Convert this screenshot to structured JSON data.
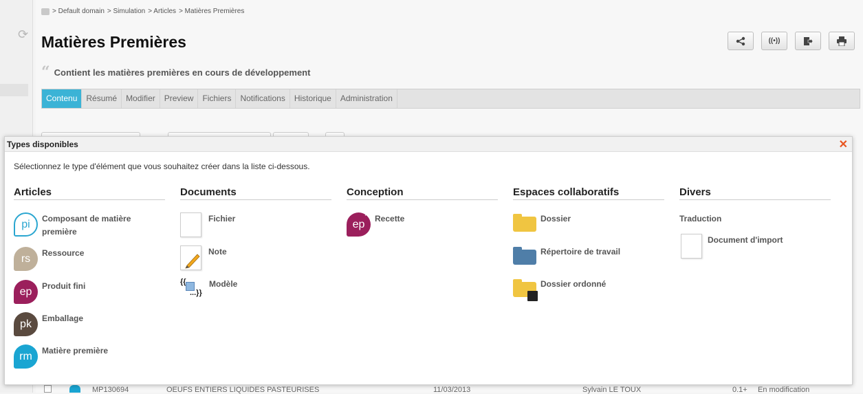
{
  "breadcrumb": [
    "> Default domain",
    "> Simulation",
    "> Articles",
    "> Matières Premières"
  ],
  "page": {
    "title": "Matières Premières",
    "description": "Contient les matières premières en cours de développement"
  },
  "actions": [
    {
      "name": "share-icon",
      "glyph": "⋔"
    },
    {
      "name": "broadcast-icon",
      "glyph": "((•))"
    },
    {
      "name": "export-icon",
      "glyph": "⇥"
    },
    {
      "name": "print-icon",
      "glyph": "⎙"
    }
  ],
  "tabs": [
    "Contenu",
    "Résumé",
    "Modifier",
    "Preview",
    "Fichiers",
    "Notifications",
    "Historique",
    "Administration"
  ],
  "active_tab": "Contenu",
  "dialog": {
    "title": "Types disponibles",
    "instruction": "Sélectionnez le type d'élément que vous souhaitez créer dans la liste ci-dessous.",
    "columns": [
      {
        "heading": "Articles",
        "items": [
          {
            "label": "Composant de matière première",
            "badge": "pi",
            "color": "#2aa6d0",
            "style": "outline"
          },
          {
            "label": "Ressource",
            "badge": "rs",
            "color": "#bfb09a"
          },
          {
            "label": "Produit fini",
            "badge": "ep",
            "color": "#9b1f5c"
          },
          {
            "label": "Emballage",
            "badge": "pk",
            "color": "#5a4a3f"
          },
          {
            "label": "Matière première",
            "badge": "rm",
            "color": "#1aa5d2"
          }
        ]
      },
      {
        "heading": "Documents",
        "items": [
          {
            "label": "Fichier",
            "icon": "file-icon"
          },
          {
            "label": "Note",
            "icon": "note-icon"
          },
          {
            "label": "Modèle",
            "icon": "template-icon"
          }
        ]
      },
      {
        "heading": "Conception",
        "items": [
          {
            "label": "Recette",
            "badge": "ep",
            "color": "#9b1f5c",
            "star": true
          }
        ]
      },
      {
        "heading": "Espaces collaboratifs",
        "items": [
          {
            "label": "Dossier",
            "icon": "folder-icon",
            "color": "#f0c541"
          },
          {
            "label": "Répertoire de travail",
            "icon": "workspace-folder-icon",
            "color": "#4f7ea8"
          },
          {
            "label": "Dossier ordonné",
            "icon": "ordered-folder-icon",
            "color": "#f0c541"
          }
        ]
      },
      {
        "heading": "Divers",
        "items": [
          {
            "label": "Traduction"
          },
          {
            "label": "Document d'import",
            "icon": "import-document-icon"
          }
        ]
      }
    ]
  },
  "background_row": {
    "code": "MP130694",
    "name": "OEUFS ENTIERS LIQUIDES PASTEURISES",
    "date": "11/03/2013",
    "author": "Sylvain LE TOUX",
    "version": "0.1+",
    "status": "En modification"
  }
}
